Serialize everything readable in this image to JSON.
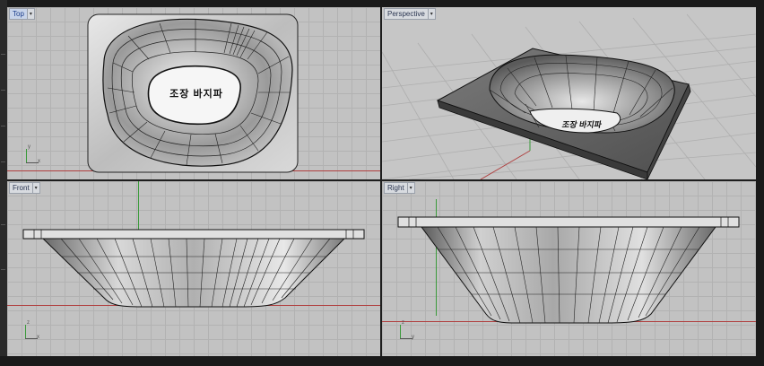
{
  "viewports": {
    "top": {
      "label": "Top"
    },
    "perspective": {
      "label": "Perspective"
    },
    "front": {
      "label": "Front"
    },
    "right": {
      "label": "Right"
    }
  },
  "engraving": {
    "text": "조장 바지파"
  },
  "axis_glyphs": {
    "y": "y",
    "x": "x",
    "z": "z"
  }
}
